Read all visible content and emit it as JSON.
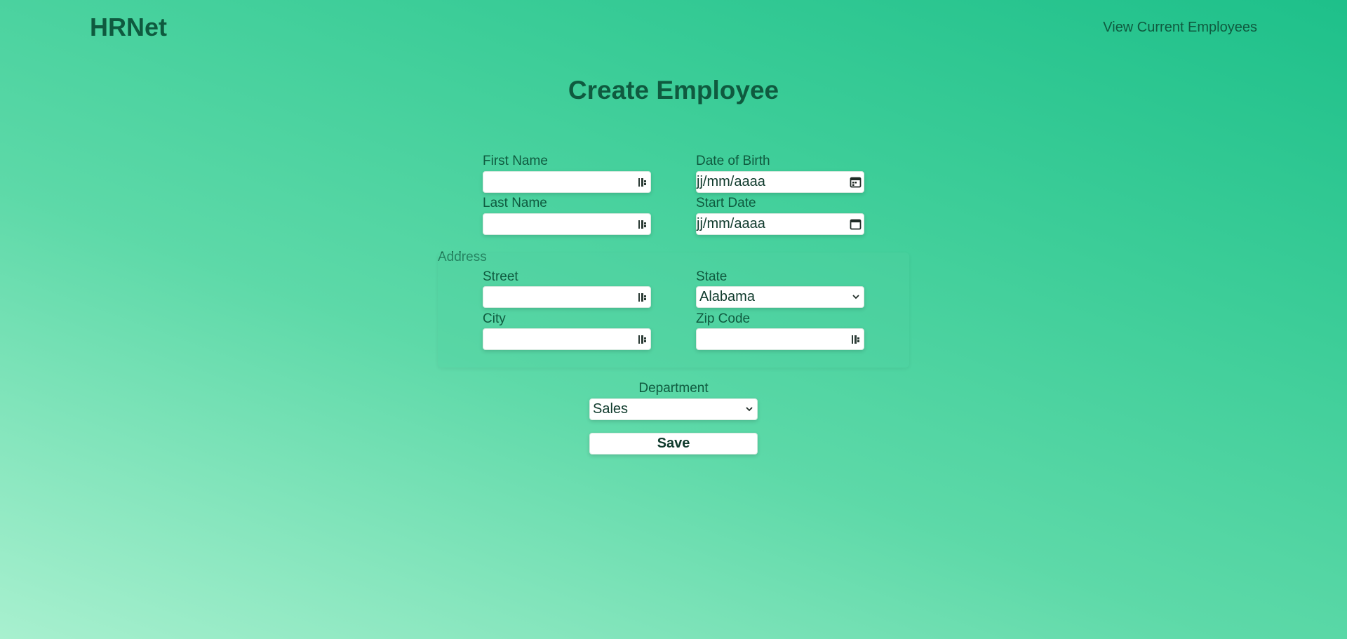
{
  "header": {
    "brand": "HRNet",
    "nav_link": "View Current Employees"
  },
  "page": {
    "title": "Create Employee"
  },
  "form": {
    "first_name": {
      "label": "First Name",
      "value": ""
    },
    "last_name": {
      "label": "Last Name",
      "value": ""
    },
    "date_of_birth": {
      "label": "Date of Birth",
      "value": "jj/mm/aaaa"
    },
    "start_date": {
      "label": "Start Date",
      "value": "jj/mm/aaaa"
    },
    "address": {
      "legend": "Address",
      "street": {
        "label": "Street",
        "value": ""
      },
      "city": {
        "label": "City",
        "value": ""
      },
      "state": {
        "label": "State",
        "selected": "Alabama"
      },
      "zip_code": {
        "label": "Zip Code",
        "value": ""
      }
    },
    "department": {
      "label": "Department",
      "selected": "Sales"
    },
    "save_label": "Save"
  },
  "icons": {
    "autofill": "autofill-key-icon",
    "calendar": "calendar-icon",
    "dropdown": "chevron-down-icon"
  },
  "colors": {
    "text": "#0f5a3f",
    "gradient_start": "#1ec08a",
    "gradient_end": "#a8f0cf",
    "field_bg": "#ffffff"
  }
}
